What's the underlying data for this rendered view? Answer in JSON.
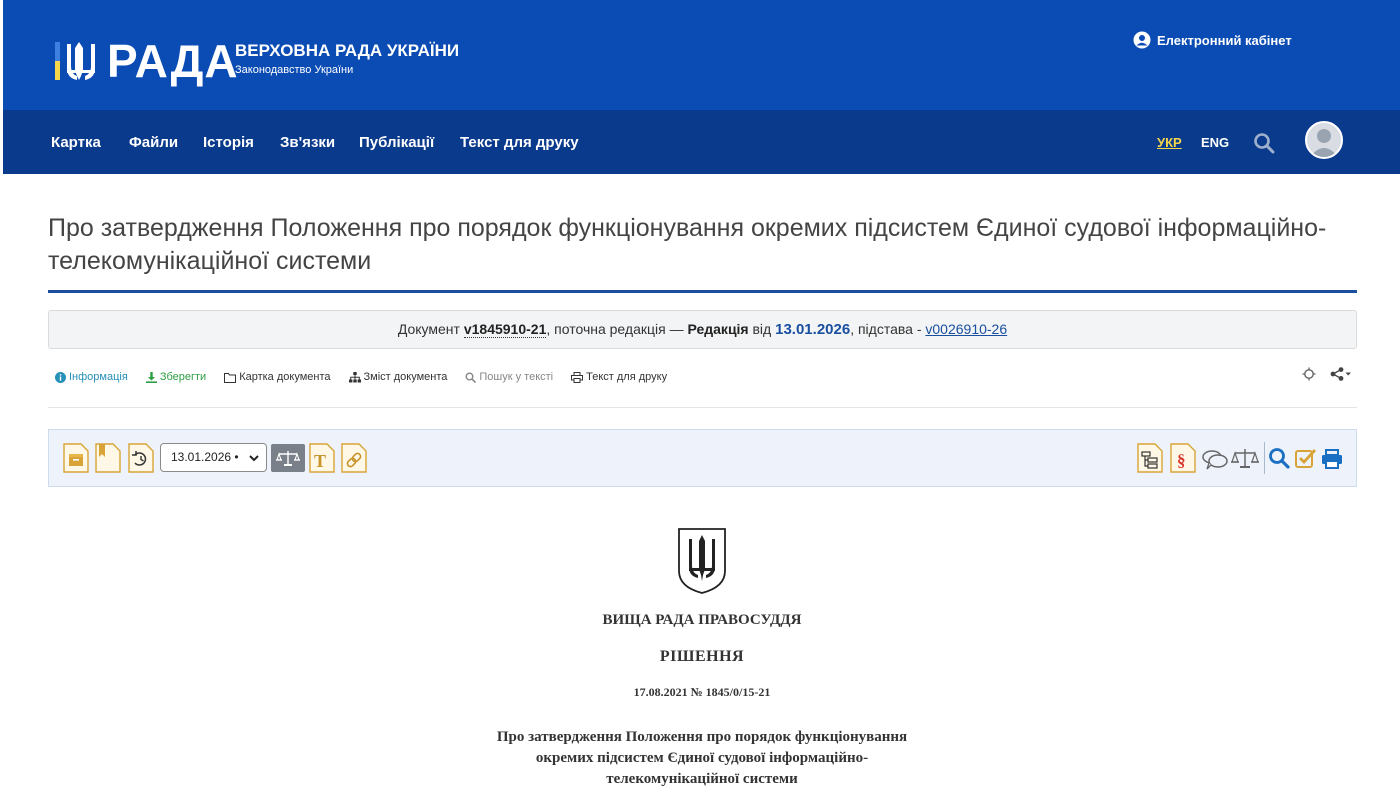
{
  "header": {
    "logo_word": "РАДА",
    "logo_title": "ВЕРХОВНА РАДА УКРАЇНИ",
    "logo_subtitle": "Законодавство України",
    "cabinet_label": "Електронний кабінет"
  },
  "nav": {
    "items": [
      "Картка",
      "Файли",
      "Історія",
      "Зв'язки",
      "Публікації",
      "Текст для друку"
    ],
    "lang_ukr": "УКР",
    "lang_eng": "ENG"
  },
  "document": {
    "title": "Про затвердження Положення про порядок функціонування окремих підсистем Єдиної судової інформаційно-телекомунікаційної системи",
    "status_prefix": "Документ ",
    "status_number": "v1845910-21",
    "status_mid": ", поточна редакція — ",
    "status_redaction": "Редакція",
    "status_from": " від ",
    "status_date": "13.01.2026",
    "status_basis": ", підстава - ",
    "status_basis_link": "v0026910-26"
  },
  "tools": {
    "info": "Інформація",
    "save": "Зберегти",
    "card": "Картка документа",
    "contents": "Зміст документа",
    "search": "Пошук у тексті",
    "print": "Текст для друку"
  },
  "toolbar": {
    "date_value": "13.01.2026 •"
  },
  "body": {
    "org": "ВИЩА РАДА ПРАВОСУДДЯ",
    "decision": "РІШЕННЯ",
    "date_number": "17.08.2021  № 1845/0/15-21",
    "title_lines": [
      "Про затвердження Положення про порядок функціонування",
      "окремих підсистем Єдиної судової інформаційно-",
      "телекомунікаційної системи"
    ]
  },
  "colors": {
    "topbar": "#0b4cb4",
    "navbar": "#0a3a8c",
    "accent": "#1a4fa0",
    "lang_active": "#f7d64a",
    "toolbar_bg": "#eef3fb"
  }
}
